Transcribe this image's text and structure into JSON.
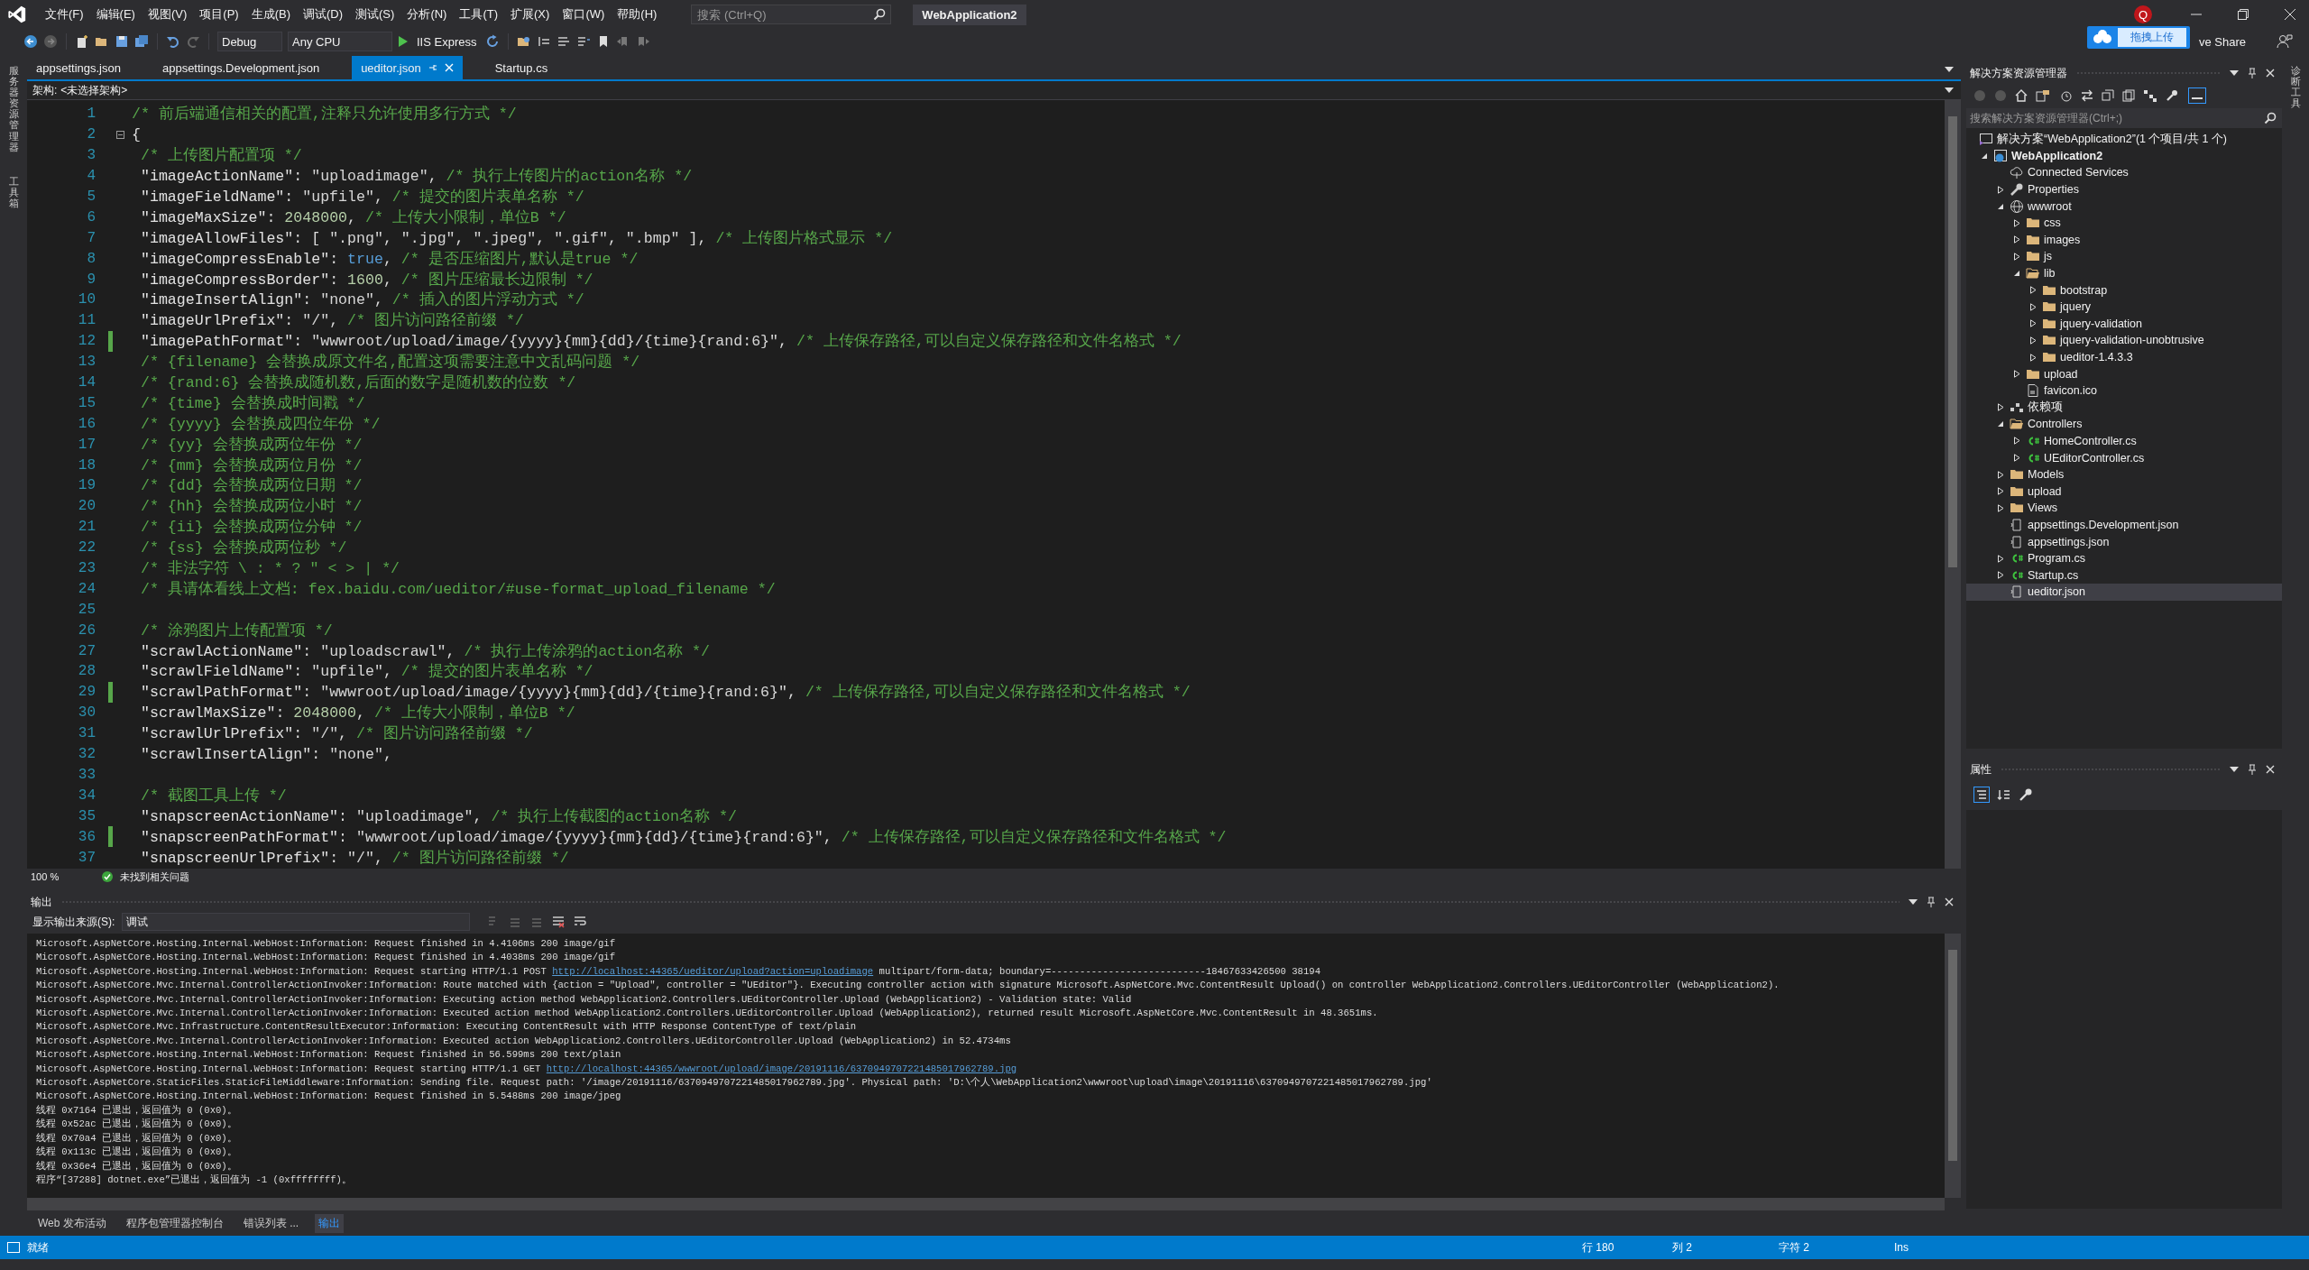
{
  "window": {
    "menu": [
      "文件(F)",
      "编辑(E)",
      "视图(V)",
      "项目(P)",
      "生成(B)",
      "调试(D)",
      "测试(S)",
      "分析(N)",
      "工具(T)",
      "扩展(X)",
      "窗口(W)",
      "帮助(H)"
    ],
    "search": {
      "placeholder": "搜索 (Ctrl+Q)"
    },
    "title": "WebApplication2",
    "account_initial": "Q",
    "upload_widget": "拖拽上传",
    "live_share": "ve Share"
  },
  "toolbar": {
    "configuration": "Debug",
    "platform": "Any CPU",
    "run": "IIS Express"
  },
  "side_tabs_left": [
    "服务器资源管理器",
    "工具箱"
  ],
  "side_tabs_right": [
    "诊断工具"
  ],
  "document_tabs": [
    {
      "label": "appsettings.json",
      "selected": false
    },
    {
      "label": "appsettings.Development.json",
      "selected": false
    },
    {
      "label": "ueditor.json",
      "selected": true
    },
    {
      "label": "Startup.cs",
      "selected": false
    }
  ],
  "schema_bar": {
    "label": "架构:",
    "value": "<未选择架构>"
  },
  "editor": {
    "lines": [
      {
        "number": "1",
        "changed": false,
        "indented": false,
        "tokens": [
          {
            "kind": "comment",
            "text": "/* 前后端通信相关的配置,注释只允许使用多行方式 */"
          }
        ]
      },
      {
        "number": "2",
        "changed": false,
        "indented": false,
        "tokens": [
          {
            "kind": "plain",
            "text": "{"
          }
        ]
      },
      {
        "number": "3",
        "changed": false,
        "indented": true,
        "tokens": [
          {
            "kind": "comment",
            "text": "/* 上传图片配置项 */"
          }
        ]
      },
      {
        "number": "4",
        "changed": false,
        "indented": true,
        "tokens": [
          {
            "kind": "key",
            "text": "\"imageActionName\""
          },
          {
            "kind": "plain",
            "text": ": "
          },
          {
            "kind": "string",
            "text": "\"uploadimage\""
          },
          {
            "kind": "plain",
            "text": ", "
          },
          {
            "kind": "comment",
            "text": "/* 执行上传图片的action名称 */"
          }
        ]
      },
      {
        "number": "5",
        "changed": false,
        "indented": true,
        "tokens": [
          {
            "kind": "key",
            "text": "\"imageFieldName\""
          },
          {
            "kind": "plain",
            "text": ": "
          },
          {
            "kind": "string",
            "text": "\"upfile\""
          },
          {
            "kind": "plain",
            "text": ", "
          },
          {
            "kind": "comment",
            "text": "/* 提交的图片表单名称 */"
          }
        ]
      },
      {
        "number": "6",
        "changed": false,
        "indented": true,
        "tokens": [
          {
            "kind": "key",
            "text": "\"imageMaxSize\""
          },
          {
            "kind": "plain",
            "text": ": "
          },
          {
            "kind": "number",
            "text": "2048000"
          },
          {
            "kind": "plain",
            "text": ", "
          },
          {
            "kind": "comment",
            "text": "/* 上传大小限制，单位B */"
          }
        ]
      },
      {
        "number": "7",
        "changed": false,
        "indented": true,
        "tokens": [
          {
            "kind": "key",
            "text": "\"imageAllowFiles\""
          },
          {
            "kind": "plain",
            "text": ": [ "
          },
          {
            "kind": "string",
            "text": "\".png\""
          },
          {
            "kind": "plain",
            "text": ", "
          },
          {
            "kind": "string",
            "text": "\".jpg\""
          },
          {
            "kind": "plain",
            "text": ", "
          },
          {
            "kind": "string",
            "text": "\".jpeg\""
          },
          {
            "kind": "plain",
            "text": ", "
          },
          {
            "kind": "string",
            "text": "\".gif\""
          },
          {
            "kind": "plain",
            "text": ", "
          },
          {
            "kind": "string",
            "text": "\".bmp\""
          },
          {
            "kind": "plain",
            "text": " ], "
          },
          {
            "kind": "comment",
            "text": "/* 上传图片格式显示 */"
          }
        ]
      },
      {
        "number": "8",
        "changed": false,
        "indented": true,
        "tokens": [
          {
            "kind": "key",
            "text": "\"imageCompressEnable\""
          },
          {
            "kind": "plain",
            "text": ": "
          },
          {
            "kind": "keyword",
            "text": "true"
          },
          {
            "kind": "plain",
            "text": ", "
          },
          {
            "kind": "comment",
            "text": "/* 是否压缩图片,默认是true */"
          }
        ]
      },
      {
        "number": "9",
        "changed": false,
        "indented": true,
        "tokens": [
          {
            "kind": "key",
            "text": "\"imageCompressBorder\""
          },
          {
            "kind": "plain",
            "text": ": "
          },
          {
            "kind": "number",
            "text": "1600"
          },
          {
            "kind": "plain",
            "text": ", "
          },
          {
            "kind": "comment",
            "text": "/* 图片压缩最长边限制 */"
          }
        ]
      },
      {
        "number": "10",
        "changed": false,
        "indented": true,
        "tokens": [
          {
            "kind": "key",
            "text": "\"imageInsertAlign\""
          },
          {
            "kind": "plain",
            "text": ": "
          },
          {
            "kind": "string",
            "text": "\"none\""
          },
          {
            "kind": "plain",
            "text": ", "
          },
          {
            "kind": "comment",
            "text": "/* 插入的图片浮动方式 */"
          }
        ]
      },
      {
        "number": "11",
        "changed": false,
        "indented": true,
        "tokens": [
          {
            "kind": "key",
            "text": "\"imageUrlPrefix\""
          },
          {
            "kind": "plain",
            "text": ": "
          },
          {
            "kind": "string",
            "text": "\"/\""
          },
          {
            "kind": "plain",
            "text": ", "
          },
          {
            "kind": "comment",
            "text": "/* 图片访问路径前缀 */"
          }
        ]
      },
      {
        "number": "12",
        "changed": true,
        "indented": true,
        "tokens": [
          {
            "kind": "key",
            "text": "\"imagePathFormat\""
          },
          {
            "kind": "plain",
            "text": ": "
          },
          {
            "kind": "string",
            "text": "\"wwwroot/upload/image/{yyyy}{mm}{dd}/{time}{rand:6}\""
          },
          {
            "kind": "plain",
            "text": ", "
          },
          {
            "kind": "comment",
            "text": "/* 上传保存路径,可以自定义保存路径和文件名格式 */"
          }
        ]
      },
      {
        "number": "13",
        "changed": false,
        "indented": true,
        "tokens": [
          {
            "kind": "comment",
            "text": "/* {filename} 会替换成原文件名,配置这项需要注意中文乱码问题 */"
          }
        ]
      },
      {
        "number": "14",
        "changed": false,
        "indented": true,
        "tokens": [
          {
            "kind": "comment",
            "text": "/* {rand:6} 会替换成随机数,后面的数字是随机数的位数 */"
          }
        ]
      },
      {
        "number": "15",
        "changed": false,
        "indented": true,
        "tokens": [
          {
            "kind": "comment",
            "text": "/* {time} 会替换成时间戳 */"
          }
        ]
      },
      {
        "number": "16",
        "changed": false,
        "indented": true,
        "tokens": [
          {
            "kind": "comment",
            "text": "/* {yyyy} 会替换成四位年份 */"
          }
        ]
      },
      {
        "number": "17",
        "changed": false,
        "indented": true,
        "tokens": [
          {
            "kind": "comment",
            "text": "/* {yy} 会替换成两位年份 */"
          }
        ]
      },
      {
        "number": "18",
        "changed": false,
        "indented": true,
        "tokens": [
          {
            "kind": "comment",
            "text": "/* {mm} 会替换成两位月份 */"
          }
        ]
      },
      {
        "number": "19",
        "changed": false,
        "indented": true,
        "tokens": [
          {
            "kind": "comment",
            "text": "/* {dd} 会替换成两位日期 */"
          }
        ]
      },
      {
        "number": "20",
        "changed": false,
        "indented": true,
        "tokens": [
          {
            "kind": "comment",
            "text": "/* {hh} 会替换成两位小时 */"
          }
        ]
      },
      {
        "number": "21",
        "changed": false,
        "indented": true,
        "tokens": [
          {
            "kind": "comment",
            "text": "/* {ii} 会替换成两位分钟 */"
          }
        ]
      },
      {
        "number": "22",
        "changed": false,
        "indented": true,
        "tokens": [
          {
            "kind": "comment",
            "text": "/* {ss} 会替换成两位秒 */"
          }
        ]
      },
      {
        "number": "23",
        "changed": false,
        "indented": true,
        "tokens": [
          {
            "kind": "comment",
            "text": "/* 非法字符 \\ : * ? \" < > | */"
          }
        ]
      },
      {
        "number": "24",
        "changed": false,
        "indented": true,
        "tokens": [
          {
            "kind": "comment",
            "text": "/* 具请体看线上文档: fex.baidu.com/ueditor/#use-format_upload_filename */"
          }
        ]
      },
      {
        "number": "25",
        "changed": false
      },
      {
        "number": "26",
        "changed": false,
        "indented": true,
        "tokens": [
          {
            "kind": "comment",
            "text": "/* 涂鸦图片上传配置项 */"
          }
        ]
      },
      {
        "number": "27",
        "changed": false,
        "indented": true,
        "tokens": [
          {
            "kind": "key",
            "text": "\"scrawlActionName\""
          },
          {
            "kind": "plain",
            "text": ": "
          },
          {
            "kind": "string",
            "text": "\"uploadscrawl\""
          },
          {
            "kind": "plain",
            "text": ", "
          },
          {
            "kind": "comment",
            "text": "/* 执行上传涂鸦的action名称 */"
          }
        ]
      },
      {
        "number": "28",
        "changed": false,
        "indented": true,
        "tokens": [
          {
            "kind": "key",
            "text": "\"scrawlFieldName\""
          },
          {
            "kind": "plain",
            "text": ": "
          },
          {
            "kind": "string",
            "text": "\"upfile\""
          },
          {
            "kind": "plain",
            "text": ", "
          },
          {
            "kind": "comment",
            "text": "/* 提交的图片表单名称 */"
          }
        ]
      },
      {
        "number": "29",
        "changed": true,
        "indented": true,
        "tokens": [
          {
            "kind": "key",
            "text": "\"scrawlPathFormat\""
          },
          {
            "kind": "plain",
            "text": ": "
          },
          {
            "kind": "string",
            "text": "\"wwwroot/upload/image/{yyyy}{mm}{dd}/{time}{rand:6}\""
          },
          {
            "kind": "plain",
            "text": ", "
          },
          {
            "kind": "comment",
            "text": "/* 上传保存路径,可以自定义保存路径和文件名格式 */"
          }
        ]
      },
      {
        "number": "30",
        "changed": false,
        "indented": true,
        "tokens": [
          {
            "kind": "key",
            "text": "\"scrawlMaxSize\""
          },
          {
            "kind": "plain",
            "text": ": "
          },
          {
            "kind": "number",
            "text": "2048000"
          },
          {
            "kind": "plain",
            "text": ", "
          },
          {
            "kind": "comment",
            "text": "/* 上传大小限制，单位B */"
          }
        ]
      },
      {
        "number": "31",
        "changed": false,
        "indented": true,
        "tokens": [
          {
            "kind": "key",
            "text": "\"scrawlUrlPrefix\""
          },
          {
            "kind": "plain",
            "text": ": "
          },
          {
            "kind": "string",
            "text": "\"/\""
          },
          {
            "kind": "plain",
            "text": ", "
          },
          {
            "kind": "comment",
            "text": "/* 图片访问路径前缀 */"
          }
        ]
      },
      {
        "number": "32",
        "changed": false,
        "indented": true,
        "tokens": [
          {
            "kind": "key",
            "text": "\"scrawlInsertAlign\""
          },
          {
            "kind": "plain",
            "text": ": "
          },
          {
            "kind": "string",
            "text": "\"none\""
          },
          {
            "kind": "plain",
            "text": ","
          }
        ]
      },
      {
        "number": "33",
        "changed": false
      },
      {
        "number": "34",
        "changed": false,
        "indented": true,
        "tokens": [
          {
            "kind": "comment",
            "text": "/* 截图工具上传 */"
          }
        ]
      },
      {
        "number": "35",
        "changed": false,
        "indented": true,
        "tokens": [
          {
            "kind": "key",
            "text": "\"snapscreenActionName\""
          },
          {
            "kind": "plain",
            "text": ": "
          },
          {
            "kind": "string",
            "text": "\"uploadimage\""
          },
          {
            "kind": "plain",
            "text": ", "
          },
          {
            "kind": "comment",
            "text": "/* 执行上传截图的action名称 */"
          }
        ]
      },
      {
        "number": "36",
        "changed": true,
        "indented": true,
        "tokens": [
          {
            "kind": "key",
            "text": "\"snapscreenPathFormat\""
          },
          {
            "kind": "plain",
            "text": ": "
          },
          {
            "kind": "string",
            "text": "\"wwwroot/upload/image/{yyyy}{mm}{dd}/{time}{rand:6}\""
          },
          {
            "kind": "plain",
            "text": ", "
          },
          {
            "kind": "comment",
            "text": "/* 上传保存路径,可以自定义保存路径和文件名格式 */"
          }
        ]
      },
      {
        "number": "37",
        "changed": false,
        "indented": true,
        "tokens": [
          {
            "kind": "key",
            "text": "\"snapscreenUrlPrefix\""
          },
          {
            "kind": "plain",
            "text": ": "
          },
          {
            "kind": "string",
            "text": "\"/\""
          },
          {
            "kind": "plain",
            "text": ", "
          },
          {
            "kind": "comment",
            "text": "/* 图片访问路径前缀 */"
          }
        ]
      }
    ],
    "zoom": "100 %",
    "issues": "未找到相关问题"
  },
  "output": {
    "title": "输出",
    "source_label": "显示输出来源(S):",
    "source": "调试",
    "lines": [
      [
        {
          "kind": "text",
          "text": "Microsoft.AspNetCore.Hosting.Internal.WebHost:Information: Request finished in 4.4106ms 200 image/gif"
        }
      ],
      [
        {
          "kind": "text",
          "text": "Microsoft.AspNetCore.Hosting.Internal.WebHost:Information: Request finished in 4.4038ms 200 image/gif"
        }
      ],
      [
        {
          "kind": "text",
          "text": "Microsoft.AspNetCore.Hosting.Internal.WebHost:Information: Request starting HTTP/1.1 POST "
        },
        {
          "kind": "link",
          "text": "http://localhost:44365/ueditor/upload?action=uploadimage"
        },
        {
          "kind": "text",
          "text": " multipart/form-data; boundary=---------------------------18467633426500 38194"
        }
      ],
      [
        {
          "kind": "text",
          "text": "Microsoft.AspNetCore.Mvc.Internal.ControllerActionInvoker:Information: Route matched with {action = \"Upload\", controller = \"UEditor\"}. Executing controller action with signature Microsoft.AspNetCore.Mvc.ContentResult Upload() on controller WebApplication2.Controllers.UEditorController (WebApplication2)."
        }
      ],
      [
        {
          "kind": "text",
          "text": "Microsoft.AspNetCore.Mvc.Internal.ControllerActionInvoker:Information: Executing action method WebApplication2.Controllers.UEditorController.Upload (WebApplication2) - Validation state: Valid"
        }
      ],
      [
        {
          "kind": "text",
          "text": "Microsoft.AspNetCore.Mvc.Internal.ControllerActionInvoker:Information: Executed action method WebApplication2.Controllers.UEditorController.Upload (WebApplication2), returned result Microsoft.AspNetCore.Mvc.ContentResult in 48.3651ms."
        }
      ],
      [
        {
          "kind": "text",
          "text": "Microsoft.AspNetCore.Mvc.Infrastructure.ContentResultExecutor:Information: Executing ContentResult with HTTP Response ContentType of text/plain"
        }
      ],
      [
        {
          "kind": "text",
          "text": "Microsoft.AspNetCore.Mvc.Internal.ControllerActionInvoker:Information: Executed action WebApplication2.Controllers.UEditorController.Upload (WebApplication2) in 52.4734ms"
        }
      ],
      [
        {
          "kind": "text",
          "text": "Microsoft.AspNetCore.Hosting.Internal.WebHost:Information: Request finished in 56.599ms 200 text/plain"
        }
      ],
      [
        {
          "kind": "text",
          "text": "Microsoft.AspNetCore.Hosting.Internal.WebHost:Information: Request starting HTTP/1.1 GET "
        },
        {
          "kind": "link",
          "text": "http://localhost:44365/wwwroot/upload/image/20191116/6370949707221485017962789.jpg"
        }
      ],
      [
        {
          "kind": "text",
          "text": "Microsoft.AspNetCore.StaticFiles.StaticFileMiddleware:Information: Sending file. Request path: '/image/20191116/6370949707221485017962789.jpg'. Physical path: 'D:\\个人\\WebApplication2\\wwwroot\\upload\\image\\20191116\\6370949707221485017962789.jpg'"
        }
      ],
      [
        {
          "kind": "text",
          "text": "Microsoft.AspNetCore.Hosting.Internal.WebHost:Information: Request finished in 5.5488ms 200 image/jpeg"
        }
      ],
      [
        {
          "kind": "text",
          "text": "线程 0x7164 已退出，返回值为 0 (0x0)。"
        }
      ],
      [
        {
          "kind": "text",
          "text": "线程 0x52ac 已退出，返回值为 0 (0x0)。"
        }
      ],
      [
        {
          "kind": "text",
          "text": "线程 0x70a4 已退出，返回值为 0 (0x0)。"
        }
      ],
      [
        {
          "kind": "text",
          "text": "线程 0x113c 已退出，返回值为 0 (0x0)。"
        }
      ],
      [
        {
          "kind": "text",
          "text": "线程 0x36e4 已退出，返回值为 0 (0x0)。"
        }
      ],
      [
        {
          "kind": "text",
          "text": "程序“[37288] dotnet.exe”已退出，返回值为 -1 (0xffffffff)。"
        }
      ]
    ]
  },
  "bottom_tabs": [
    {
      "label": "Web 发布活动",
      "selected": false
    },
    {
      "label": "程序包管理器控制台",
      "selected": false
    },
    {
      "label": "错误列表 ...",
      "selected": false
    },
    {
      "label": "输出",
      "selected": true
    }
  ],
  "solution_explorer": {
    "title": "解决方案资源管理器",
    "search": {
      "placeholder": "搜索解决方案资源管理器(Ctrl+;)"
    },
    "tree": [
      {
        "label": "解决方案“WebApplication2”(1 个项目/共 1 个)",
        "kind": "solution",
        "selected": false
      },
      {
        "label": "WebApplication2",
        "kind": "project",
        "selected": false,
        "expanded": true,
        "children": [
          {
            "label": "Connected Services",
            "kind": "services",
            "selected": false
          },
          {
            "label": "Properties",
            "kind": "properties",
            "selected": false,
            "expanded": false
          },
          {
            "label": "wwwroot",
            "kind": "web",
            "selected": false,
            "expanded": true,
            "children": [
              {
                "label": "css",
                "kind": "folder",
                "selected": false,
                "expanded": false
              },
              {
                "label": "images",
                "kind": "folder",
                "selected": false,
                "expanded": false
              },
              {
                "label": "js",
                "kind": "folder",
                "selected": false,
                "expanded": false
              },
              {
                "label": "lib",
                "kind": "folder",
                "selected": false,
                "expanded": true,
                "children": [
                  {
                    "label": "bootstrap",
                    "kind": "folder",
                    "selected": false,
                    "expanded": false
                  },
                  {
                    "label": "jquery",
                    "kind": "folder",
                    "selected": false,
                    "expanded": false
                  },
                  {
                    "label": "jquery-validation",
                    "kind": "folder",
                    "selected": false,
                    "expanded": false
                  },
                  {
                    "label": "jquery-validation-unobtrusive",
                    "kind": "folder",
                    "selected": false,
                    "expanded": false
                  },
                  {
                    "label": "ueditor-1.4.3.3",
                    "kind": "folder",
                    "selected": false,
                    "expanded": false
                  }
                ]
              },
              {
                "label": "upload",
                "kind": "folder",
                "selected": false,
                "expanded": false
              },
              {
                "label": "favicon.ico",
                "kind": "file",
                "selected": false
              }
            ]
          },
          {
            "label": "依赖项",
            "kind": "dependencies",
            "selected": false,
            "expanded": false
          },
          {
            "label": "Controllers",
            "kind": "folder",
            "selected": false,
            "expanded": true,
            "children": [
              {
                "label": "HomeController.cs",
                "kind": "csharp",
                "selected": false,
                "expanded": false
              },
              {
                "label": "UEditorController.cs",
                "kind": "csharp",
                "selected": false,
                "expanded": false
              }
            ]
          },
          {
            "label": "Models",
            "kind": "folder",
            "selected": false,
            "expanded": false
          },
          {
            "label": "upload",
            "kind": "folder",
            "selected": false,
            "expanded": false
          },
          {
            "label": "Views",
            "kind": "folder",
            "selected": false,
            "expanded": false
          },
          {
            "label": "appsettings.Development.json",
            "kind": "json",
            "selected": false
          },
          {
            "label": "appsettings.json",
            "kind": "json",
            "selected": false
          },
          {
            "label": "Program.cs",
            "kind": "csharp",
            "selected": false,
            "expanded": false
          },
          {
            "label": "Startup.cs",
            "kind": "csharp",
            "selected": false,
            "expanded": false
          },
          {
            "label": "ueditor.json",
            "kind": "json",
            "selected": true
          }
        ]
      }
    ]
  },
  "properties": {
    "title": "属性"
  },
  "status_bar": {
    "state": "就绪",
    "line": "行 180",
    "column": "列 2",
    "char": "字符 2",
    "mode": "Ins"
  }
}
